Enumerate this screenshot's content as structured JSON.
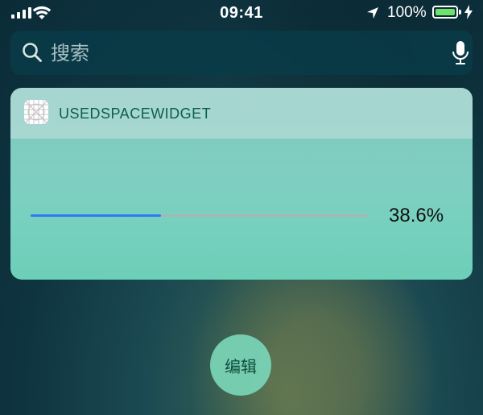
{
  "status_bar": {
    "time": "09:41",
    "battery_percent": "100%",
    "battery_level": 1.0,
    "icons": [
      "signal-icon",
      "wifi-icon",
      "location-arrow-icon",
      "battery-icon",
      "charging-bolt-icon"
    ]
  },
  "search": {
    "placeholder": "搜索",
    "value": "",
    "icons": [
      "search-icon",
      "mic-icon"
    ]
  },
  "widget": {
    "title": "USEDSPACEWIDGET",
    "icon": "app-icon",
    "progress_value": 0.386,
    "progress_label": "38.6%"
  },
  "edit_button": {
    "label": "编辑"
  },
  "colors": {
    "progress_fill": "#2a7cf5",
    "progress_track": "#a7b5b6",
    "battery_fill": "#6ee36b",
    "widget_title": "#0e5f4e"
  }
}
